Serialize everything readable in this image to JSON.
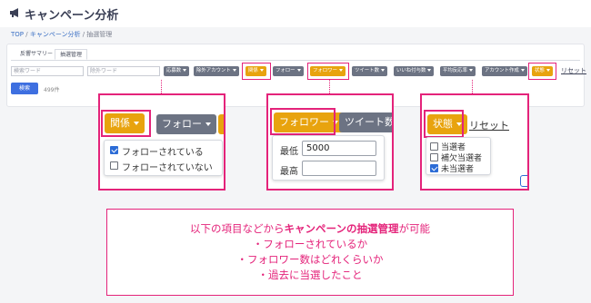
{
  "app": {
    "title": "キャンペーン分析",
    "breadcrumb": {
      "top": "TOP",
      "sep1": " / ",
      "campaign": "キャンペーン分析",
      "sep2": " / ",
      "current": "抽選管理"
    }
  },
  "tabs": [
    {
      "label": "反響サマリー"
    },
    {
      "label": "抽選管理"
    }
  ],
  "filters": {
    "search_placeholder": "検索ワード",
    "exclude_placeholder": "除外ワード",
    "buttons": [
      "応募数",
      "除外アカウント",
      "関係",
      "フォロー",
      "フォロワー",
      "ツイート数",
      "いいね付与数",
      "平均反応率",
      "アカウント作成",
      "状態"
    ],
    "reset": "リセット",
    "search": "検索",
    "count": "499件"
  },
  "zoom_relation": {
    "btn_relation": "関係",
    "btn_follow": "フォロー",
    "options": [
      {
        "label": "フォローされている",
        "checked": true
      },
      {
        "label": "フォローされていない",
        "checked": false
      }
    ]
  },
  "zoom_follower": {
    "btn_follower": "フォロワー",
    "btn_tweets": "ツイート数",
    "min_label": "最低",
    "min_value": "5000",
    "max_label": "最高",
    "max_value": ""
  },
  "zoom_status": {
    "btn_status": "状態",
    "reset": "リセット",
    "options": [
      {
        "label": "当選者",
        "checked": false
      },
      {
        "label": "補欠当選者",
        "checked": false
      },
      {
        "label": "未当選者",
        "checked": true
      }
    ]
  },
  "note": {
    "line1_pre": "以下の項目などから",
    "line1_bold": "キャンペーンの抽選管理",
    "line1_post": "が可能",
    "line2": "・フォローされているか",
    "line3": "・フォロワー数はどれくらいか",
    "line4": "・過去に当選したこと"
  },
  "colors": {
    "accent": "#e4237a",
    "yellow_button": "#e8a30e",
    "gray_button": "#6c7383",
    "primary": "#3e6fe0"
  }
}
